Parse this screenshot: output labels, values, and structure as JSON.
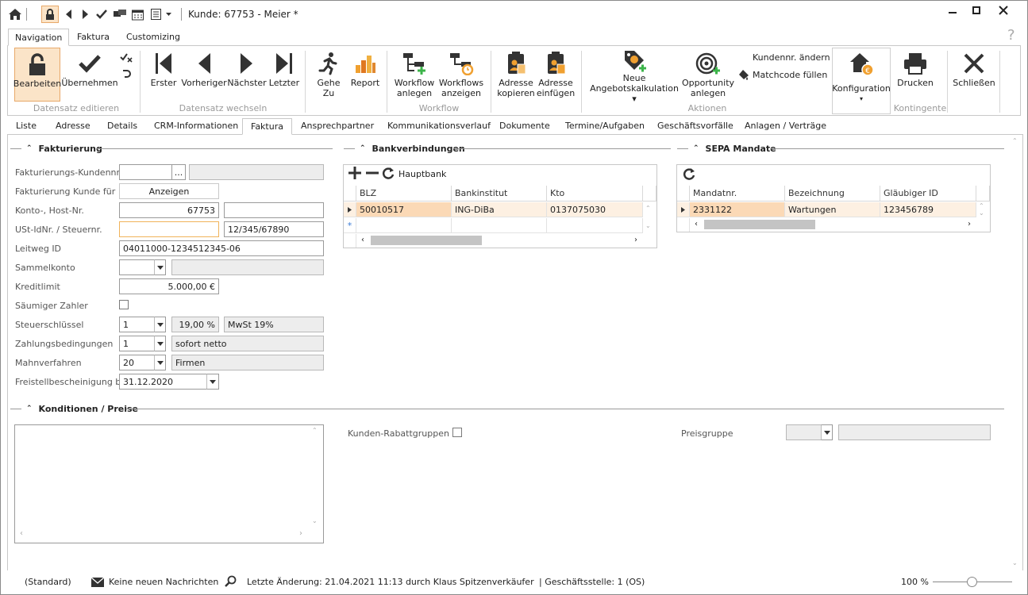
{
  "window": {
    "title": "Kunde: 67753 - Meier *",
    "help": "?"
  },
  "ribbon_tabs": [
    "Navigation",
    "Faktura",
    "Customizing"
  ],
  "ribbon": {
    "bearbeiten": "Bearbeiten",
    "uebernehmen": "Übernehmen",
    "group_edit": "Datensatz editieren",
    "erster": "Erster",
    "vorheriger": "Vorheriger",
    "naechster": "Nächster",
    "letzter": "Letzter",
    "group_nav": "Datensatz wechseln",
    "gehe_zu_1": "Gehe",
    "gehe_zu_2": "Zu",
    "report": "Report",
    "wf_anlegen_1": "Workflow",
    "wf_anlegen_2": "anlegen",
    "wf_anzeigen_1": "Workflows",
    "wf_anzeigen_2": "anzeigen",
    "group_workflow": "Workflow",
    "adr_kopieren_1": "Adresse",
    "adr_kopieren_2": "kopieren",
    "adr_einfuegen_1": "Adresse",
    "adr_einfuegen_2": "einfügen",
    "neue_1": "Neue",
    "neue_2": "Angebotskalkulation",
    "opp_1": "Opportunity",
    "opp_2": "anlegen",
    "kundennr_aendern": "Kundennr. ändern",
    "matchcode_fuellen": "Matchcode füllen",
    "group_aktionen": "Aktionen",
    "konfiguration": "Konfiguration",
    "drucken": "Drucken",
    "schliessen": "Schließen",
    "group_kontingente": "Kontingente"
  },
  "page_tabs": [
    "Liste",
    "Adresse",
    "Details",
    "CRM-Informationen",
    "Faktura",
    "Ansprechpartner",
    "Kommunikationsverlauf",
    "Dokumente",
    "Termine/Aufgaben",
    "Geschäftsvorfälle",
    "Anlagen / Verträge"
  ],
  "fakturierung": {
    "header": "Fakturierung",
    "kundennr_label": "Fakturierungs-Kundennr.",
    "kundennr_value": "",
    "kundennr_btn": "...",
    "kunde_fuer_label": "Fakturierung Kunde für",
    "anzeigen": "Anzeigen",
    "konto_label": "Konto-, Host-Nr.",
    "konto_value": "67753",
    "host_value": "",
    "ust_label": "USt-IdNr. / Steuernr.",
    "ust_value": "",
    "steuernr_value": "12/345/67890",
    "leitweg_label": "Leitweg ID",
    "leitweg_value": "04011000-1234512345-06",
    "sammelkonto_label": "Sammelkonto",
    "kreditlimit_label": "Kreditlimit",
    "kreditlimit_value": "5.000,00 €",
    "saeumig_label": "Säumiger Zahler",
    "steuerschluessel_label": "Steuerschlüssel",
    "steuerschluessel_value": "1",
    "steuer_pct": "19,00 %",
    "steuer_desc": "MwSt 19%",
    "zahlung_label": "Zahlungsbedingungen",
    "zahlung_value": "1",
    "zahlung_desc": "sofort netto",
    "mahn_label": "Mahnverfahren",
    "mahn_value": "20",
    "mahn_desc": "Firmen",
    "freistell_label": "Freistellbescheinigung bis",
    "freistell_value": "31.12.2020"
  },
  "bank": {
    "header": "Bankverbindungen",
    "hauptbank": "Hauptbank",
    "columns": [
      "BLZ",
      "Bankinstitut",
      "Kto"
    ],
    "rows": [
      [
        "50010517",
        "ING-DiBa",
        "0137075030"
      ]
    ]
  },
  "sepa": {
    "header": "SEPA Mandate",
    "columns": [
      "Mandatnr.",
      "Bezeichnung",
      "Gläubiger ID"
    ],
    "rows": [
      [
        "2331122",
        "Wartungen",
        "123456789"
      ]
    ]
  },
  "konditionen": {
    "header": "Konditionen / Preise",
    "rabatt_label": "Kunden-Rabattgruppen",
    "preisgruppe_label": "Preisgruppe"
  },
  "status": {
    "standard": "(Standard)",
    "messages": "Keine neuen Nachrichten",
    "last_change": "Letzte Änderung: 21.04.2021 11:13 durch Klaus Spitzenverkäufer",
    "branch": "| Geschäftsstelle:  1 (OS)",
    "zoom": "100 %"
  },
  "colors": {
    "selected_bg": "#fbe4c8",
    "highlight_row": "#fdf0e2",
    "accent_orange": "#f0a030",
    "green_plus": "#3cb44a"
  }
}
